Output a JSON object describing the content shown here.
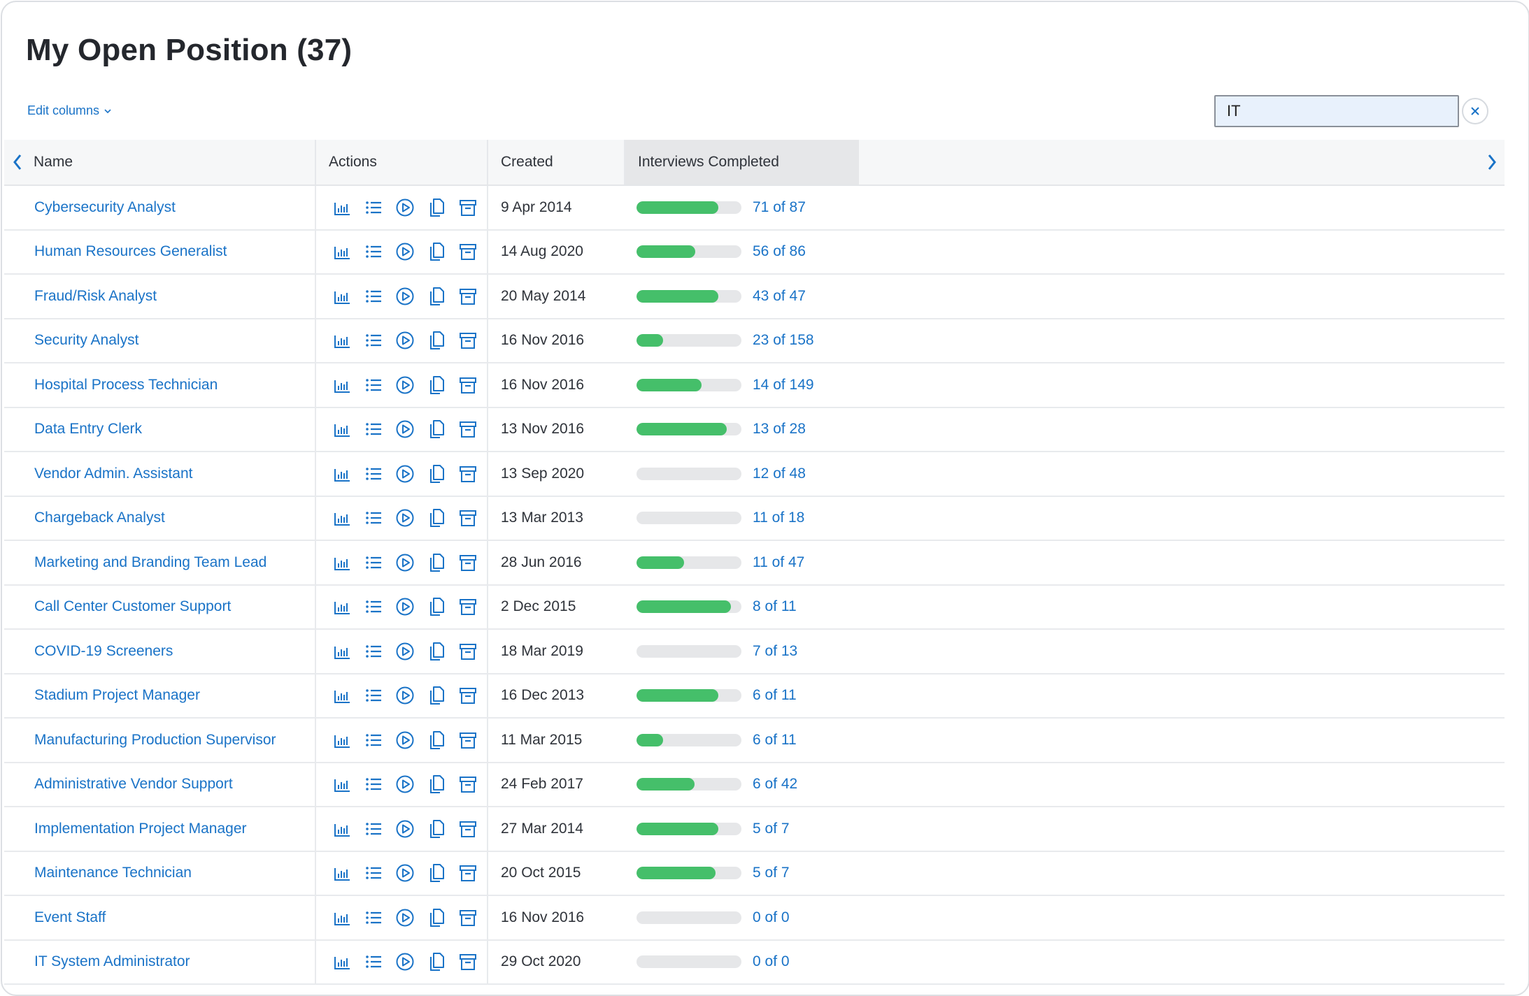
{
  "page": {
    "title": "My Open Position (37)",
    "edit_columns_label": "Edit columns",
    "search_value": "IT"
  },
  "colors": {
    "link": "#1a73c7",
    "progress_fill": "#45bf6a",
    "progress_track": "#e6e7e9",
    "search_bg": "#e8f1fc"
  },
  "columns": {
    "name": "Name",
    "actions": "Actions",
    "created": "Created",
    "interviews": "Interviews Completed"
  },
  "action_icons": [
    "bar-chart-icon",
    "list-icon",
    "play-circle-icon",
    "copy-icon",
    "archive-icon"
  ],
  "rows": [
    {
      "name": "Cybersecurity Analyst",
      "created": "9 Apr 2014",
      "interviews": "71 of 87",
      "progress": 0.78
    },
    {
      "name": "Human Resources Generalist",
      "created": "14 Aug 2020",
      "interviews": "56 of 86",
      "progress": 0.56
    },
    {
      "name": "Fraud/Risk Analyst",
      "created": "20 May 2014",
      "interviews": "43 of 47",
      "progress": 0.78
    },
    {
      "name": "Security Analyst",
      "created": "16 Nov 2016",
      "interviews": "23 of 158",
      "progress": 0.25
    },
    {
      "name": "Hospital Process Technician",
      "created": "16 Nov 2016",
      "interviews": "14 of 149",
      "progress": 0.62
    },
    {
      "name": "Data Entry Clerk",
      "created": "13 Nov 2016",
      "interviews": "13 of 28",
      "progress": 0.86
    },
    {
      "name": "Vendor Admin. Assistant",
      "created": "13 Sep 2020",
      "interviews": "12 of 48",
      "progress": 0.0
    },
    {
      "name": "Chargeback Analyst",
      "created": "13 Mar 2013",
      "interviews": "11 of 18",
      "progress": 0.0
    },
    {
      "name": "Marketing and Branding Team Lead",
      "created": "28 Jun 2016",
      "interviews": "11 of 47",
      "progress": 0.45
    },
    {
      "name": "Call Center Customer Support",
      "created": "2 Dec 2015",
      "interviews": "8 of 11",
      "progress": 0.9
    },
    {
      "name": "COVID-19 Screeners",
      "created": "18 Mar 2019",
      "interviews": "7 of 13",
      "progress": 0.0
    },
    {
      "name": "Stadium Project Manager",
      "created": "16 Dec 2013",
      "interviews": "6 of 11",
      "progress": 0.78
    },
    {
      "name": "Manufacturing Production Supervisor",
      "created": "11 Mar 2015",
      "interviews": "6 of 11",
      "progress": 0.25
    },
    {
      "name": "Administrative Vendor Support",
      "created": "24 Feb 2017",
      "interviews": "6 of 42",
      "progress": 0.55
    },
    {
      "name": "Implementation Project Manager",
      "created": "27 Mar 2014",
      "interviews": "5 of 7",
      "progress": 0.78
    },
    {
      "name": "Maintenance Technician",
      "created": "20 Oct 2015",
      "interviews": "5 of 7",
      "progress": 0.75
    },
    {
      "name": "Event Staff",
      "created": "16 Nov 2016",
      "interviews": "0 of 0",
      "progress": 0.0
    },
    {
      "name": "IT System Administrator",
      "created": "29 Oct 2020",
      "interviews": "0 of 0",
      "progress": 0.0
    }
  ]
}
